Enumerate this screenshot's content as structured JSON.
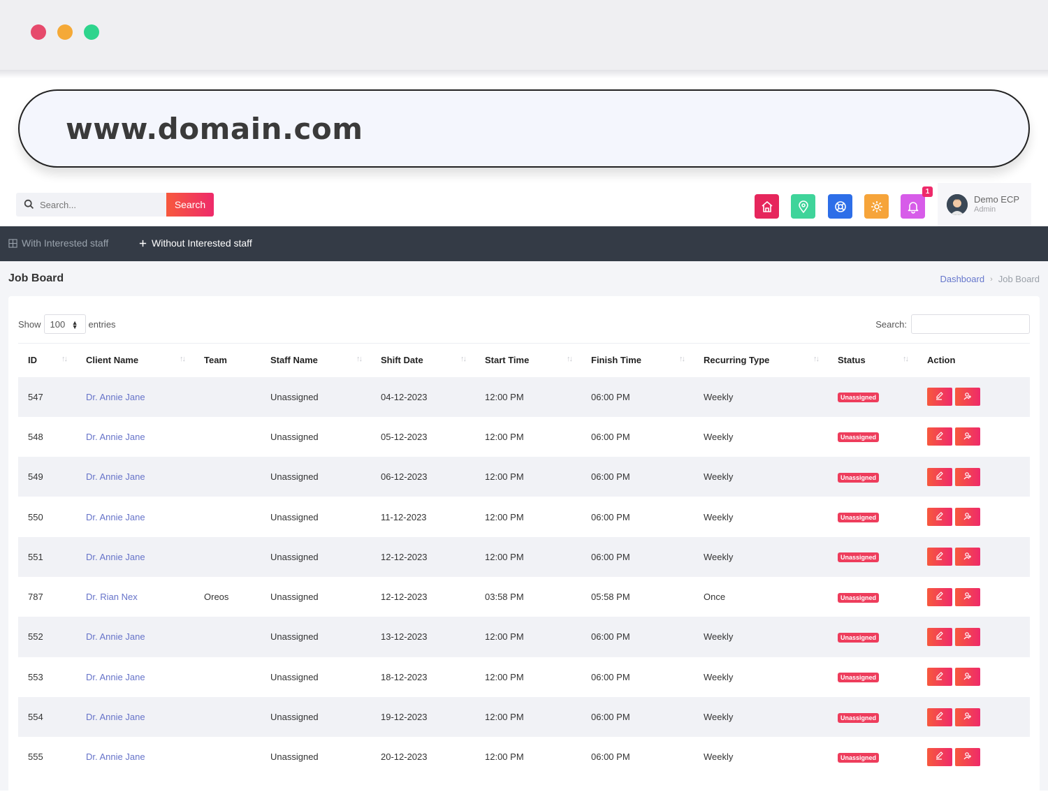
{
  "browser": {
    "url": "www.domain.com"
  },
  "header": {
    "search_placeholder": "Search...",
    "search_button": "Search",
    "notification_count": "1",
    "user": {
      "name": "Demo ECP",
      "role": "Admin"
    },
    "colors": {
      "accent_from": "#f7593d",
      "accent_to": "#ee2a6a",
      "nav_bg": "#343b46"
    }
  },
  "nav": {
    "tabs": [
      {
        "label": "With Interested staff",
        "active": false
      },
      {
        "label": "Without Interested staff",
        "active": true
      }
    ]
  },
  "page": {
    "title": "Job Board",
    "breadcrumb": {
      "home": "Dashboard",
      "current": "Job Board"
    }
  },
  "table": {
    "show_label": "Show",
    "entries_value": "100",
    "entries_label": "entries",
    "search_label": "Search:",
    "columns": [
      "ID",
      "Client Name",
      "Team",
      "Staff Name",
      "Shift Date",
      "Start Time",
      "Finish Time",
      "Recurring Type",
      "Status",
      "Action"
    ],
    "rows": [
      {
        "id": "547",
        "client": "Dr. Annie Jane",
        "team": "",
        "staff": "Unassigned",
        "date": "04-12-2023",
        "start": "12:00 PM",
        "finish": "06:00 PM",
        "recurring": "Weekly",
        "status": "Unassigned"
      },
      {
        "id": "548",
        "client": "Dr. Annie Jane",
        "team": "",
        "staff": "Unassigned",
        "date": "05-12-2023",
        "start": "12:00 PM",
        "finish": "06:00 PM",
        "recurring": "Weekly",
        "status": "Unassigned"
      },
      {
        "id": "549",
        "client": "Dr. Annie Jane",
        "team": "",
        "staff": "Unassigned",
        "date": "06-12-2023",
        "start": "12:00 PM",
        "finish": "06:00 PM",
        "recurring": "Weekly",
        "status": "Unassigned"
      },
      {
        "id": "550",
        "client": "Dr. Annie Jane",
        "team": "",
        "staff": "Unassigned",
        "date": "11-12-2023",
        "start": "12:00 PM",
        "finish": "06:00 PM",
        "recurring": "Weekly",
        "status": "Unassigned"
      },
      {
        "id": "551",
        "client": "Dr. Annie Jane",
        "team": "",
        "staff": "Unassigned",
        "date": "12-12-2023",
        "start": "12:00 PM",
        "finish": "06:00 PM",
        "recurring": "Weekly",
        "status": "Unassigned"
      },
      {
        "id": "787",
        "client": "Dr. Rian Nex",
        "team": "Oreos",
        "staff": "Unassigned",
        "date": "12-12-2023",
        "start": "03:58 PM",
        "finish": "05:58 PM",
        "recurring": "Once",
        "status": "Unassigned"
      },
      {
        "id": "552",
        "client": "Dr. Annie Jane",
        "team": "",
        "staff": "Unassigned",
        "date": "13-12-2023",
        "start": "12:00 PM",
        "finish": "06:00 PM",
        "recurring": "Weekly",
        "status": "Unassigned"
      },
      {
        "id": "553",
        "client": "Dr. Annie Jane",
        "team": "",
        "staff": "Unassigned",
        "date": "18-12-2023",
        "start": "12:00 PM",
        "finish": "06:00 PM",
        "recurring": "Weekly",
        "status": "Unassigned"
      },
      {
        "id": "554",
        "client": "Dr. Annie Jane",
        "team": "",
        "staff": "Unassigned",
        "date": "19-12-2023",
        "start": "12:00 PM",
        "finish": "06:00 PM",
        "recurring": "Weekly",
        "status": "Unassigned"
      },
      {
        "id": "555",
        "client": "Dr. Annie Jane",
        "team": "",
        "staff": "Unassigned",
        "date": "20-12-2023",
        "start": "12:00 PM",
        "finish": "06:00 PM",
        "recurring": "Weekly",
        "status": "Unassigned"
      }
    ]
  }
}
